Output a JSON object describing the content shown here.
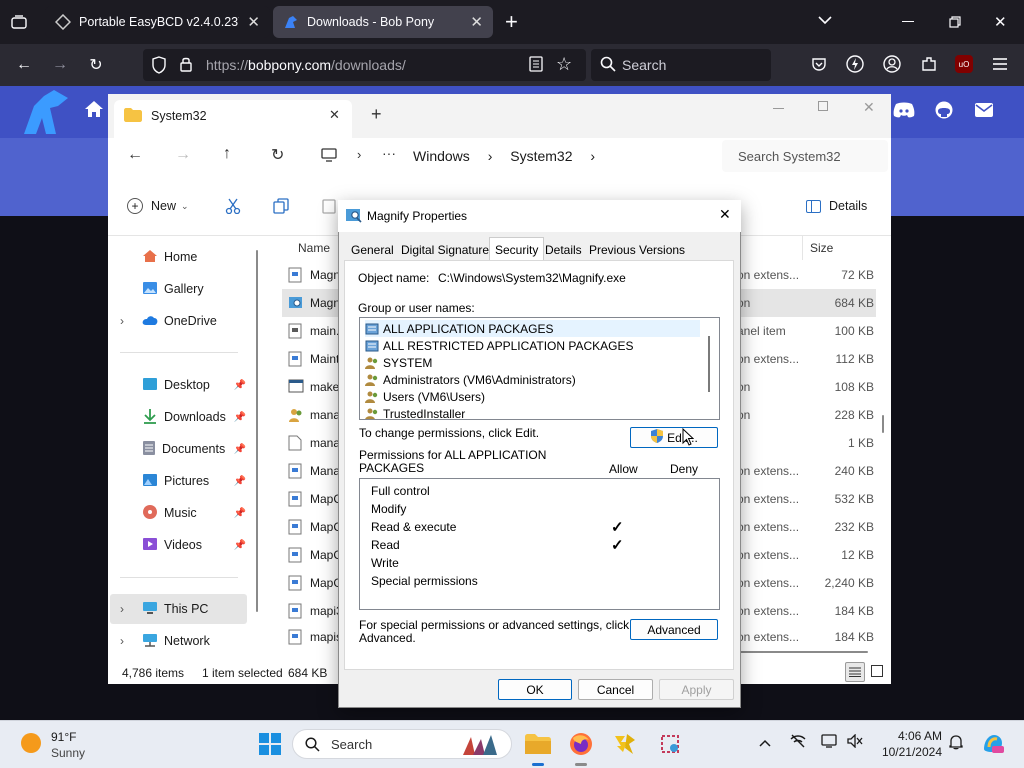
{
  "browser": {
    "tabs": [
      {
        "title": "Portable EasyBCD v2.4.0.237 Co",
        "active": false
      },
      {
        "title": "Downloads - Bob Pony",
        "active": true
      }
    ],
    "new_tab": "+",
    "url_prefix": "https://",
    "url_host": "bobpony.com",
    "url_path": "/downloads/",
    "search_placeholder": "Search"
  },
  "explorer": {
    "tab_title": "System32",
    "breadcrumb": [
      "Windows",
      "System32"
    ],
    "search_placeholder": "Search System32",
    "new_label": "New",
    "details_label": "Details",
    "columns": {
      "name": "Name",
      "size": "Size"
    },
    "sidebar": [
      {
        "label": "Home",
        "icon": "home-icon"
      },
      {
        "label": "Gallery",
        "icon": "gallery-icon"
      },
      {
        "label": "OneDrive",
        "icon": "cloud-icon"
      },
      {
        "label": "Desktop",
        "icon": "desktop-icon"
      },
      {
        "label": "Downloads",
        "icon": "download-icon"
      },
      {
        "label": "Documents",
        "icon": "document-icon"
      },
      {
        "label": "Pictures",
        "icon": "pictures-icon"
      },
      {
        "label": "Music",
        "icon": "music-icon"
      },
      {
        "label": "Videos",
        "icon": "videos-icon"
      },
      {
        "label": "This PC",
        "icon": "pc-icon"
      },
      {
        "label": "Network",
        "icon": "network-icon"
      }
    ],
    "files": [
      {
        "name": "Magn",
        "type": "on extens...",
        "size": "72 KB"
      },
      {
        "name": "Magn",
        "type": "on",
        "size": "684 KB"
      },
      {
        "name": "main.c",
        "type": "anel item",
        "size": "100 KB"
      },
      {
        "name": "Maint",
        "type": "on extens...",
        "size": "112 KB"
      },
      {
        "name": "make",
        "type": "on",
        "size": "108 KB"
      },
      {
        "name": "mana",
        "type": "on",
        "size": "228 KB"
      },
      {
        "name": "mana",
        "type": "",
        "size": "1 KB"
      },
      {
        "name": "Mana",
        "type": "on extens...",
        "size": "240 KB"
      },
      {
        "name": "MapC",
        "type": "on extens...",
        "size": "532 KB"
      },
      {
        "name": "MapC",
        "type": "on extens...",
        "size": "232 KB"
      },
      {
        "name": "MapC",
        "type": "on extens...",
        "size": "12 KB"
      },
      {
        "name": "MapG",
        "type": "on extens...",
        "size": "2,240 KB"
      },
      {
        "name": "mapi3",
        "type": "on extens...",
        "size": "184 KB"
      },
      {
        "name": "mapis",
        "type": "on extens...",
        "size": "184 KB"
      }
    ],
    "status": {
      "items": "4,786 items",
      "selected": "1 item selected",
      "size": "684 KB"
    }
  },
  "dialog": {
    "title": "Magnify Properties",
    "tabs": [
      "General",
      "Digital Signatures",
      "Security",
      "Details",
      "Previous Versions"
    ],
    "active_tab": "Security",
    "object_label": "Object name:",
    "object_value": "C:\\Windows\\System32\\Magnify.exe",
    "group_label": "Group or user names:",
    "groups": [
      "ALL APPLICATION PACKAGES",
      "ALL RESTRICTED APPLICATION PACKAGES",
      "SYSTEM",
      "Administrators (VM6\\Administrators)",
      "Users (VM6\\Users)",
      "TrustedInstaller"
    ],
    "change_text": "To change permissions, click Edit.",
    "edit_label": "Edit...",
    "perm_header_line1": "Permissions for ALL APPLICATION",
    "perm_header_line2": "PACKAGES",
    "allow_label": "Allow",
    "deny_label": "Deny",
    "permissions": [
      {
        "name": "Full control",
        "allow": false
      },
      {
        "name": "Modify",
        "allow": false
      },
      {
        "name": "Read & execute",
        "allow": true
      },
      {
        "name": "Read",
        "allow": true
      },
      {
        "name": "Write",
        "allow": false
      },
      {
        "name": "Special permissions",
        "allow": false
      }
    ],
    "check_mark": "✓",
    "advanced_text_line1": "For special permissions or advanced settings, click",
    "advanced_text_line2": "Advanced.",
    "advanced_label": "Advanced",
    "ok_label": "OK",
    "cancel_label": "Cancel",
    "apply_label": "Apply"
  },
  "taskbar": {
    "weather_temp": "91°F",
    "weather_desc": "Sunny",
    "search_label": "Search",
    "time": "4:06 AM",
    "date": "10/21/2024"
  },
  "colors": {
    "banner": "#5063ce",
    "dialog_bg": "#f0f0f0",
    "accent": "#0067c0"
  }
}
